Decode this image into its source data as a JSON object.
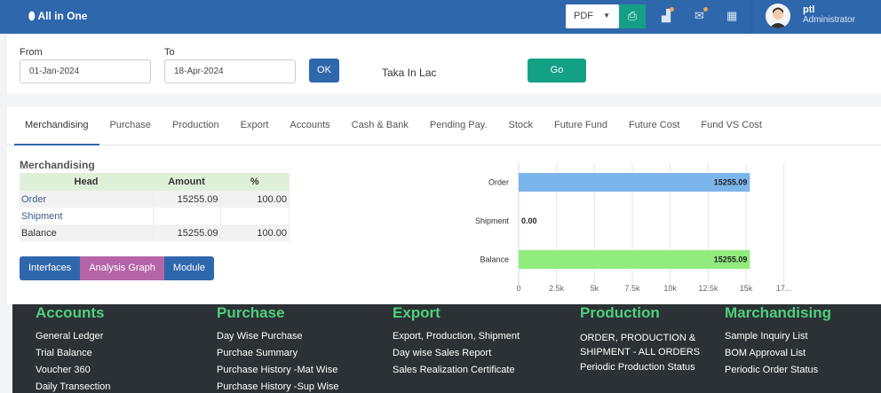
{
  "header": {
    "brand": "All in One",
    "export_format": "PDF",
    "user_name": "ptl",
    "user_role": "Administrator"
  },
  "filter": {
    "from_label": "From",
    "from_value": "01-Jan-2024",
    "to_label": "To",
    "to_value": "18-Apr-2024",
    "ok_label": "OK",
    "unit_label": "Taka In Lac",
    "go_label": "Go"
  },
  "tabs": [
    "Merchandising",
    "Purchase",
    "Production",
    "Export",
    "Accounts",
    "Cash & Bank",
    "Pending Pay.",
    "Stock",
    "Future Fund",
    "Future Cost",
    "Fund VS Cost"
  ],
  "section": {
    "title": "Merchandising",
    "headers": [
      "Head",
      "Amount",
      "%"
    ],
    "rows": [
      [
        "Order",
        "15255.09",
        "100.00"
      ],
      [
        "Shipment",
        "",
        ""
      ],
      [
        "Balance",
        "15255.09",
        "100.00"
      ]
    ]
  },
  "buttons": [
    "Interfaces",
    "Analysis Graph",
    "Module"
  ],
  "colors": {
    "header": "#2f67ad",
    "order_bar": "#7cb5ec",
    "balance_bar": "#90ed7d",
    "footer": "#2b3134",
    "footer_heading": "#4fce7e"
  },
  "chart_data": {
    "type": "bar",
    "orientation": "horizontal",
    "categories": [
      "Order",
      "Shipment",
      "Balance"
    ],
    "values": [
      15255.09,
      0,
      15255.09
    ],
    "labels": [
      "15255.09",
      "0.00",
      "15255.09"
    ],
    "xlim": [
      0,
      17500
    ],
    "xticks": [
      "0",
      "2.5k",
      "5k",
      "7.5k",
      "10k",
      "12.5k",
      "15k",
      "17..."
    ],
    "grid": true
  },
  "footer": [
    {
      "title": "Accounts",
      "items": [
        "General Ledger",
        "Trial Balance",
        "Voucher 360",
        "Daily Transection"
      ]
    },
    {
      "title": "Purchase",
      "items": [
        "Day Wise Purchase",
        "Purchae Summary",
        "Purchase History -Mat Wise",
        "Purchase History -Sup Wise"
      ]
    },
    {
      "title": "Export",
      "items": [
        "Export, Production, Shipment",
        "Day wise Sales Report",
        "Sales Realization Certificate"
      ]
    },
    {
      "title": "Production",
      "items": [
        "ORDER, PRODUCTION & SHIPMENT - ALL ORDERS",
        "Periodic Production Status"
      ]
    },
    {
      "title": "Marchandising",
      "items": [
        "Sample Inquiry List",
        "BOM Approval List",
        "Periodic Order Status"
      ]
    }
  ]
}
